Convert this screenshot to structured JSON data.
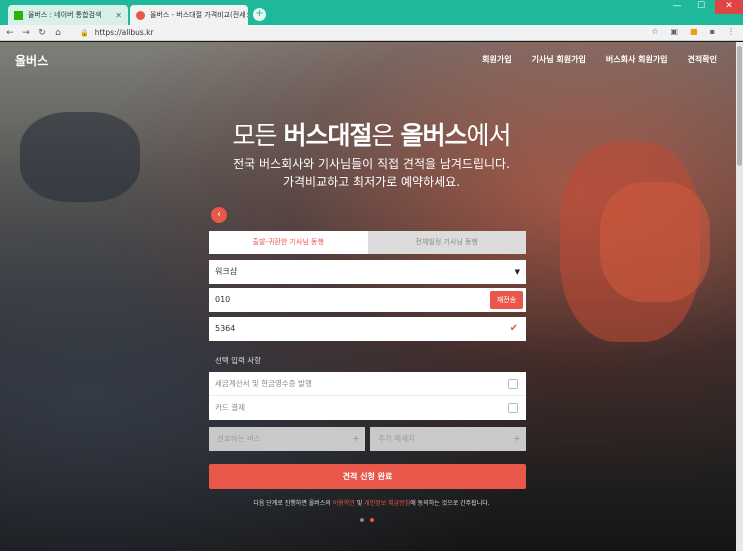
{
  "browser": {
    "tabs": [
      {
        "title": "올버스 : 네이버 통합검색",
        "active": false
      },
      {
        "title": "올버스 - 버스대절 가격비교(전세",
        "active": true
      }
    ],
    "url": "https://allbus.kr",
    "new_tab": "+",
    "window_controls": {
      "minimize": "—",
      "maximize": "☐",
      "close": "✕"
    }
  },
  "header": {
    "logo": "올버스",
    "nav": [
      "회원가입",
      "기사님 회원가입",
      "버스회사 회원가입",
      "견적확인"
    ]
  },
  "hero": {
    "title_prefix": "모든 ",
    "title_bold1": "버스대절",
    "title_mid": "은 ",
    "title_bold2": "올버스",
    "title_suffix": "에서",
    "subtitle_line1": "전국 버스회사와 기사님들이 직접 견적을 남겨드립니다.",
    "subtitle_line2": "가격비교하고 최저가로 예약하세요."
  },
  "form": {
    "tabs": [
      {
        "label": "출발-귀환한 기사님 동행",
        "active": true
      },
      {
        "label": "전체일정 기사님 동행",
        "active": false
      }
    ],
    "purpose_select": "워크샵",
    "phone_prefix": "010",
    "verify_button": "재전송",
    "verify_code": "5364",
    "optional_label": "선택 입력 사항",
    "options": [
      {
        "label": "세금계산서 및 현금영수증 발행",
        "checked": false
      },
      {
        "label": "카드 결제",
        "checked": false
      }
    ],
    "preferred_bus": "선호하는 버스",
    "extra_message": "추가 메세지",
    "submit": "견적 신청 완료"
  },
  "legal": {
    "pre": "다음 단계로 진행하면 올버스의 ",
    "terms": "이용약관",
    "mid": " 및 ",
    "privacy": "개인정보 취급방침",
    "post": "에 동의하는 것으로 간주됩니다."
  },
  "carousel": {
    "total": 2,
    "active_index": 1
  },
  "colors": {
    "accent": "#e8574a",
    "chrome": "#1fb89a"
  }
}
